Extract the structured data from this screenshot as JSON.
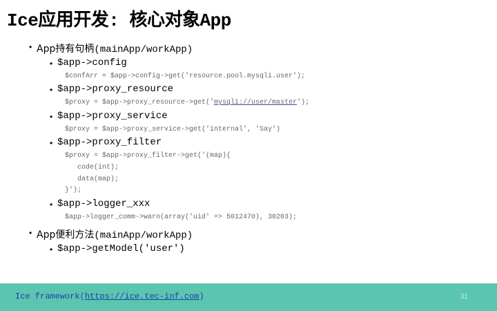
{
  "slide": {
    "title": "Ice应用开发: 核心对象App",
    "section1": {
      "bullet": "•",
      "label_prefix": "App",
      "label_zh": "持有句柄",
      "label_suffix": "(mainApp/workApp)",
      "items": [
        {
          "bullet": "•",
          "label": "$app->config",
          "code_lines": [
            "$confArr = $app->config->get('resource.pool.mysqli.user');"
          ]
        },
        {
          "bullet": "•",
          "label": "$app->proxy_resource",
          "code_before": "$proxy = $app->proxy_resource->get('",
          "code_link": "mysqli://user/master",
          "code_after": "');"
        },
        {
          "bullet": "•",
          "label": "$app->proxy_service",
          "code_lines": [
            "$proxy = $app->proxy_service->get('internal', 'Say')"
          ]
        },
        {
          "bullet": "•",
          "label": "$app->proxy_filter",
          "code_lines": [
            "$proxy = $app->proxy_filter->get('(map){",
            "code(int);",
            "data(map);",
            "}');"
          ]
        },
        {
          "bullet": "•",
          "label": "$app->logger_xxx",
          "code_lines": [
            "$app->logger_comm->warn(array('uid' => 5012470), 30203);"
          ]
        }
      ]
    },
    "section2": {
      "bullet": "•",
      "label_prefix": "App",
      "label_zh": "便利方法",
      "label_suffix": "(mainApp/workApp)",
      "items": [
        {
          "bullet": "•",
          "label": "$app->getModel('user')"
        }
      ]
    }
  },
  "footer": {
    "prefix": "Ice framework(",
    "url": "https://ice.tec-inf.com",
    "suffix": ")",
    "page_number": "31",
    "background": "#5cc5b0"
  }
}
